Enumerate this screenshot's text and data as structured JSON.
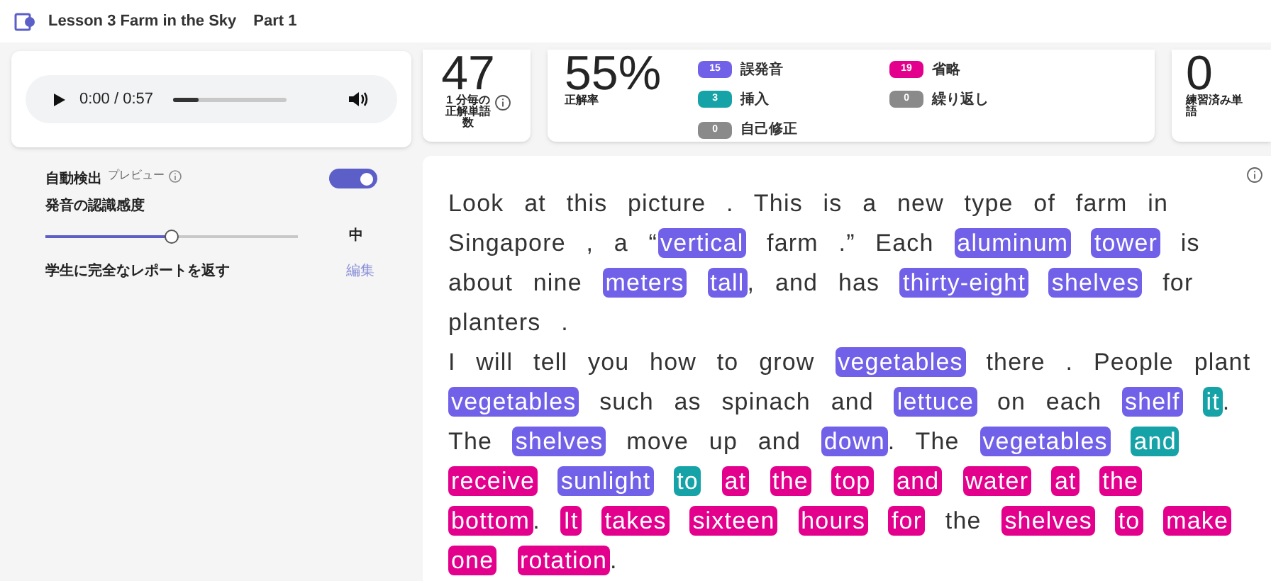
{
  "header": {
    "title": "Lesson 3 Farm in the Sky",
    "part": "Part 1"
  },
  "audio": {
    "time": "0:00 / 0:57",
    "level": 0.22
  },
  "settings": {
    "auto_detect": {
      "label": "自動検出",
      "badge": "プレビュー",
      "on": true
    },
    "sensitivity": {
      "label": "発音の認識感度",
      "level": 0.5,
      "value": "中"
    },
    "report": {
      "label": "学生に完全なレポートを返す",
      "action": "編集"
    }
  },
  "stats": [
    {
      "kind": "wcpm",
      "value": "47",
      "label": "1 分毎の正解単語数"
    },
    {
      "kind": "accuracy",
      "value": "55%",
      "label": "正解率",
      "legend": [
        {
          "kind": "mispronunciation",
          "count": "15",
          "label": "誤発音"
        },
        {
          "kind": "insertion",
          "count": "3",
          "label": "挿入"
        },
        {
          "kind": "self_correction",
          "count": "0",
          "label": "自己修正"
        },
        {
          "kind": "omission",
          "count": "19",
          "label": "省略"
        },
        {
          "kind": "repetition",
          "count": "0",
          "label": "繰り返し"
        }
      ]
    },
    {
      "kind": "practiced",
      "value": "0",
      "label": "練習済み単語"
    }
  ],
  "passage": [
    [
      {
        "text": "Look",
        "kind": "plain"
      },
      {
        "text": "at",
        "kind": "plain"
      },
      {
        "text": "this",
        "kind": "plain"
      },
      {
        "text": "picture .",
        "kind": "plain"
      },
      {
        "text": "This",
        "kind": "plain"
      },
      {
        "text": "is",
        "kind": "plain"
      },
      {
        "text": "a",
        "kind": "plain"
      },
      {
        "text": "new",
        "kind": "plain"
      },
      {
        "text": "type",
        "kind": "plain"
      },
      {
        "text": "of",
        "kind": "plain"
      },
      {
        "text": "farm",
        "kind": "plain"
      },
      {
        "text": "in",
        "kind": "plain"
      },
      {
        "text": "Singapore ,",
        "kind": "plain"
      },
      {
        "text": "a",
        "kind": "plain"
      },
      {
        "text": "“",
        "kind": "open"
      },
      {
        "text": "vertical",
        "kind": "mispronunciation"
      },
      {
        "text": "farm .”",
        "kind": "plain"
      },
      {
        "text": "Each",
        "kind": "plain"
      },
      {
        "text": "aluminum",
        "kind": "mispronunciation"
      },
      {
        "text": "tower",
        "kind": "mispronunciation"
      },
      {
        "text": "is",
        "kind": "plain"
      },
      {
        "text": "about",
        "kind": "plain"
      },
      {
        "text": "nine",
        "kind": "plain"
      },
      {
        "text": "meters",
        "kind": "mispronunciation"
      },
      {
        "text": "tall",
        "kind": "mispronunciation"
      },
      {
        "text": ",",
        "kind": "punct"
      },
      {
        "text": "and",
        "kind": "plain"
      },
      {
        "text": "has",
        "kind": "plain"
      },
      {
        "text": "thirty-eight",
        "kind": "mispronunciation"
      },
      {
        "text": "shelves",
        "kind": "mispronunciation"
      },
      {
        "text": "for",
        "kind": "plain"
      },
      {
        "text": "planters .",
        "kind": "plain"
      }
    ],
    [
      {
        "text": "I",
        "kind": "plain"
      },
      {
        "text": "will",
        "kind": "plain"
      },
      {
        "text": "tell",
        "kind": "plain"
      },
      {
        "text": "you",
        "kind": "plain"
      },
      {
        "text": "how",
        "kind": "plain"
      },
      {
        "text": "to",
        "kind": "plain"
      },
      {
        "text": "grow",
        "kind": "plain"
      },
      {
        "text": "vegetables",
        "kind": "mispronunciation"
      },
      {
        "text": "there .",
        "kind": "plain"
      },
      {
        "text": "People",
        "kind": "plain"
      },
      {
        "text": "plant",
        "kind": "plain"
      },
      {
        "text": "vegetables",
        "kind": "mispronunciation"
      },
      {
        "text": "such",
        "kind": "plain"
      },
      {
        "text": "as",
        "kind": "plain"
      },
      {
        "text": "spinach",
        "kind": "plain"
      },
      {
        "text": "and",
        "kind": "plain"
      },
      {
        "text": "lettuce",
        "kind": "mispronunciation"
      },
      {
        "text": "on",
        "kind": "plain"
      },
      {
        "text": "each",
        "kind": "plain"
      },
      {
        "text": "shelf",
        "kind": "mispronunciation"
      },
      {
        "text": "it",
        "kind": "insertion"
      },
      {
        "text": ".",
        "kind": "punct"
      },
      {
        "text": "The",
        "kind": "plain"
      },
      {
        "text": "shelves",
        "kind": "mispronunciation"
      },
      {
        "text": "move",
        "kind": "plain"
      },
      {
        "text": "up",
        "kind": "plain"
      },
      {
        "text": "and",
        "kind": "plain"
      },
      {
        "text": "down",
        "kind": "mispronunciation"
      },
      {
        "text": ".",
        "kind": "punct"
      },
      {
        "text": "The",
        "kind": "plain"
      },
      {
        "text": "vegetables",
        "kind": "mispronunciation"
      },
      {
        "text": "and",
        "kind": "insertion"
      },
      {
        "text": "receive",
        "kind": "omission"
      },
      {
        "text": "sunlight",
        "kind": "mispronunciation"
      },
      {
        "text": "to",
        "kind": "insertion"
      },
      {
        "text": "at",
        "kind": "omission"
      },
      {
        "text": "the",
        "kind": "omission"
      },
      {
        "text": "top",
        "kind": "omission"
      },
      {
        "text": "and",
        "kind": "omission"
      },
      {
        "text": "water",
        "kind": "omission"
      },
      {
        "text": "at",
        "kind": "omission"
      },
      {
        "text": "the",
        "kind": "omission"
      },
      {
        "text": "bottom",
        "kind": "omission"
      },
      {
        "text": ".",
        "kind": "punct"
      },
      {
        "text": "It",
        "kind": "omission"
      },
      {
        "text": "takes",
        "kind": "omission"
      },
      {
        "text": "sixteen",
        "kind": "omission"
      },
      {
        "text": "hours",
        "kind": "omission"
      },
      {
        "text": "for",
        "kind": "omission"
      },
      {
        "text": "the",
        "kind": "plain"
      },
      {
        "text": "shelves",
        "kind": "omission"
      },
      {
        "text": "to",
        "kind": "omission"
      },
      {
        "text": "make",
        "kind": "omission"
      },
      {
        "text": "one",
        "kind": "omission"
      },
      {
        "text": "rotation",
        "kind": "omission"
      },
      {
        "text": ".",
        "kind": "punct"
      }
    ]
  ]
}
